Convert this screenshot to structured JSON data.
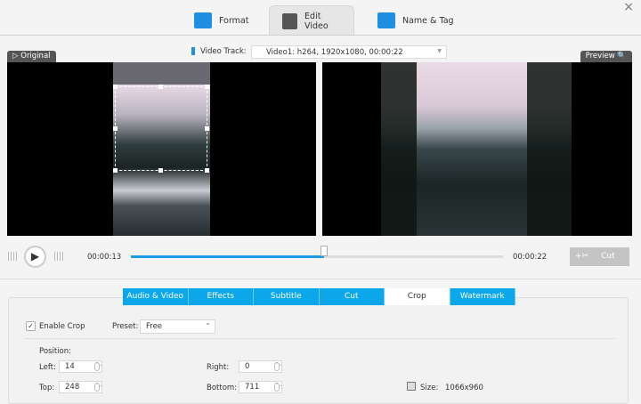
{
  "tabs": [
    {
      "label": "Format",
      "icon": "format-icon"
    },
    {
      "label": "Edit Video",
      "icon": "edit-video-icon",
      "active": true
    },
    {
      "label": "Name & Tag",
      "icon": "name-tag-icon"
    }
  ],
  "close_label": "×",
  "video_track": {
    "label": "Video Track:",
    "value": "Video1: h264, 1920x1080, 00:00:22"
  },
  "original_label": "Original",
  "preview_label": "Preview",
  "playback": {
    "current": "00:00:13",
    "total": "00:00:22",
    "progress": 0.52,
    "cut_label": "Cut"
  },
  "subtabs": [
    "Audio & Video",
    "Effects",
    "Subtitle",
    "Cut",
    "Crop",
    "Watermark"
  ],
  "active_subtab": "Crop",
  "crop": {
    "enable_label": "Enable Crop",
    "enabled": true,
    "preset_label": "Preset:",
    "preset_value": "Free",
    "position_label": "Position:",
    "left_label": "Left:",
    "left": "14",
    "right_label": "Right:",
    "right": "0",
    "top_label": "Top:",
    "top": "248",
    "bottom_label": "Bottom:",
    "bottom": "711",
    "size_label": "Size:",
    "size": "1066x960"
  },
  "colors": {
    "accent": "#0ba7ea",
    "progress": "#1e9be8"
  }
}
